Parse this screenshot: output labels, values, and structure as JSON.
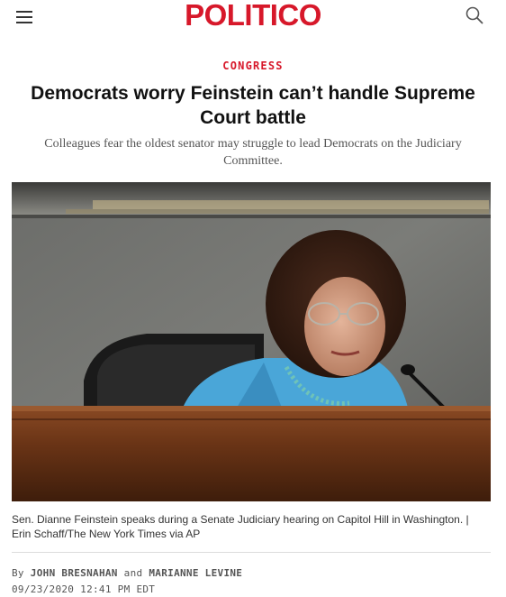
{
  "header": {
    "logo": "POLITICO",
    "menu_icon": "hamburger-menu-icon",
    "search_icon": "search-icon",
    "brand_color": "#d7182a"
  },
  "article": {
    "section": "CONGRESS",
    "headline": "Democrats worry Feinstein can’t handle Supreme Court battle",
    "dek": "Colleagues fear the oldest senator may struggle to lead Democrats on the Judiciary Committee.",
    "caption": "Sen. Dianne Feinstein speaks during a Senate Judiciary hearing on Capitol Hill in Washington. | Erin Schaff/The New York Times via AP",
    "byline": {
      "prefix": "By",
      "author1": "JOHN BRESNAHAN",
      "joiner": "and",
      "author2": "MARIANNE LEVINE"
    },
    "timestamp": "09/23/2020 12:41 PM EDT"
  }
}
